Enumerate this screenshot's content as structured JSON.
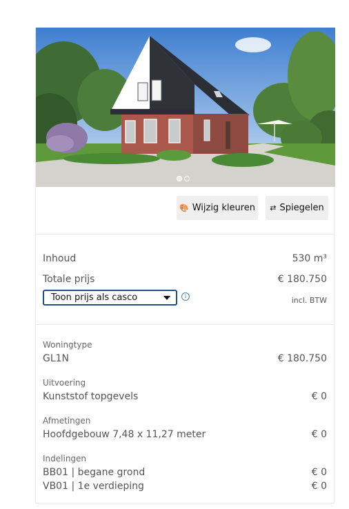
{
  "carousel": {
    "dot_count": 2,
    "active_index": 0
  },
  "toolbar": {
    "kleuren_label": "Wijzig kleuren",
    "kleuren_icon": "palette-icon",
    "spiegel_label": "Spiegelen",
    "spiegel_icon": "swap-arrows-icon"
  },
  "summary": {
    "inhoud_label": "Inhoud",
    "inhoud_value": "530 m³",
    "totaal_label": "Totale prijs",
    "totaal_value": "€ 180.750",
    "select_value": "Toon prijs als casco",
    "info_glyph": "i",
    "btw_label": "incl. BTW"
  },
  "details": {
    "woningtype_label": "Woningtype",
    "woningtype_value": "GL1N",
    "woningtype_price": "€ 180.750",
    "uitvoering_label": "Uitvoering",
    "uitvoering_value": "Kunststof topgevels",
    "uitvoering_price": "€ 0",
    "afmetingen_label": "Afmetingen",
    "afmetingen_value": "Hoofdgebouw 7,48 x 11,27 meter",
    "afmetingen_price": "€ 0",
    "indelingen_label": "Indelingen",
    "indelingen": [
      {
        "value": "BB01 | begane grond",
        "price": "€ 0"
      },
      {
        "value": "VB01 | 1e verdieping",
        "price": "€ 0"
      }
    ]
  },
  "colors": {
    "select_border": "#1d4f8f",
    "info": "#3f7fbf",
    "button_bg": "#efefef",
    "divider": "#ebebeb"
  }
}
